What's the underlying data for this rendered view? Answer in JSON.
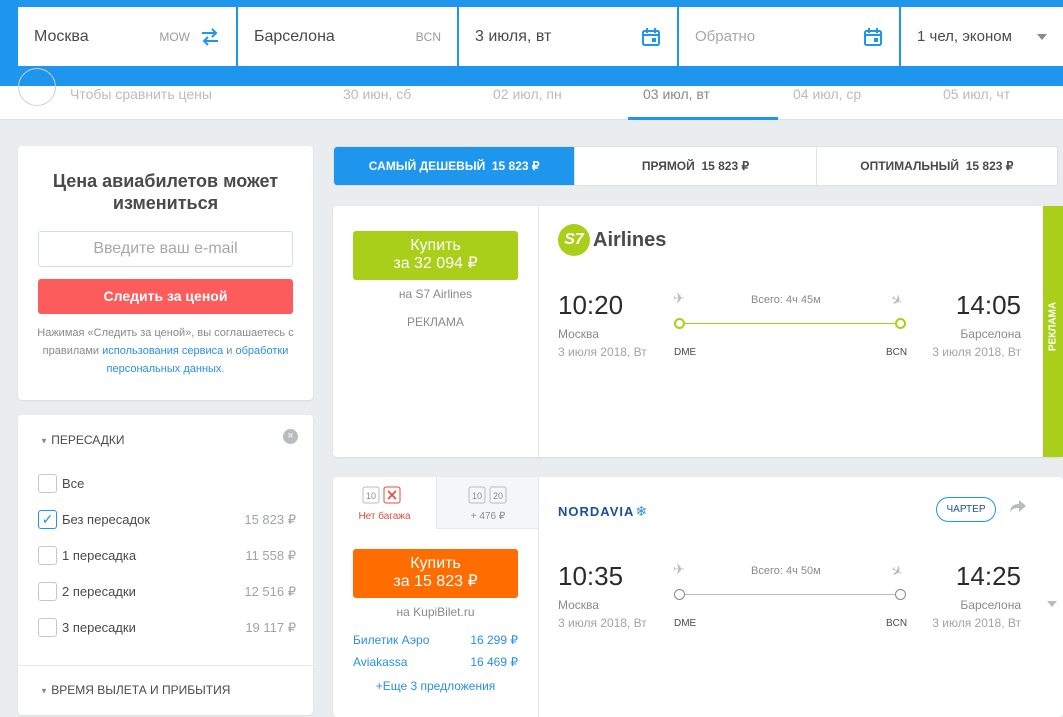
{
  "search": {
    "from_city": "Москва",
    "from_code": "MOW",
    "to_city": "Барселона",
    "to_code": "BCN",
    "depart_date": "3 июля, вт",
    "return_placeholder": "Обратно",
    "passengers": "1 чел, эконом"
  },
  "datebar": {
    "compare_text": "Чтобы сравнить цены",
    "dates": [
      "30 июн, сб",
      "02 июл, пн",
      "03 июл, вт",
      "04 июл, ср",
      "05 июл, чт"
    ]
  },
  "price_alert": {
    "title": "Цена авиабилетов может измениться",
    "email_placeholder": "Введите ваш e-mail",
    "button": "Следить за ценой",
    "agree_text_1": "Нажимая «Следить за ценой», вы соглашаетесь с правилами",
    "agree_link_1": "использования сервиса",
    "agree_and": "и",
    "agree_link_2": "обработки персональных данных",
    "agree_end": "."
  },
  "filters": {
    "stops_title": "ПЕРЕСАДКИ",
    "options": [
      {
        "label": "Все",
        "price": "",
        "checked": false
      },
      {
        "label": "Без пересадок",
        "price": "15 823 ₽",
        "checked": true
      },
      {
        "label": "1 пересадка",
        "price": "11 558 ₽",
        "checked": false
      },
      {
        "label": "2 пересадки",
        "price": "12 516 ₽",
        "checked": false
      },
      {
        "label": "3 пересадки",
        "price": "19 117 ₽",
        "checked": false
      }
    ],
    "times_title": "ВРЕМЯ ВЫЛЕТА И ПРИБЫТИЯ"
  },
  "sort_tabs": [
    {
      "label": "САМЫЙ ДЕШЕВЫЙ",
      "price": "15 823 ₽"
    },
    {
      "label": "ПРЯМОЙ",
      "price": "15 823 ₽"
    },
    {
      "label": "ОПТИМАЛЬНЫЙ",
      "price": "15 823 ₽"
    }
  ],
  "ticket1": {
    "buy_label": "Купить",
    "buy_price": "за 32 094 ₽",
    "seller": "на S7 Airlines",
    "ad_label": "РЕКЛАМА",
    "airline_logo_text": "S7",
    "airline_name": "Airlines",
    "dep_time": "10:20",
    "dep_city": "Москва",
    "dep_date": "3 июля 2018, Вт",
    "dep_iata": "DME",
    "arr_time": "14:05",
    "arr_city": "Барселона",
    "arr_date": "3 июля 2018, Вт",
    "arr_iata": "BCN",
    "duration": "Всего: 4ч 45м",
    "side_label": "РЕКЛАМА"
  },
  "ticket2": {
    "bag_option_1": "Нет багажа",
    "bag_option_2": "+ 476 ₽",
    "bag_weight_a": "10",
    "bag_weight_b": "20",
    "buy_label": "Купить",
    "buy_price": "за 15 823 ₽",
    "seller": "на KupiBilet.ru",
    "offers": [
      {
        "name": "Билетик Аэро",
        "price": "16 299 ₽"
      },
      {
        "name": "Aviakassa",
        "price": "16 469 ₽"
      }
    ],
    "more_offers": "+Еще 3 предложения",
    "airline_name": "NORDAVIA",
    "charter_badge": "ЧАРТЕР",
    "dep_time": "10:35",
    "dep_city": "Москва",
    "dep_date": "3 июля 2018, Вт",
    "dep_iata": "DME",
    "arr_time": "14:25",
    "arr_city": "Барселона",
    "arr_date": "3 июля 2018, Вт",
    "arr_iata": "BCN",
    "duration": "Всего: 4ч 50м"
  },
  "colors": {
    "accent": "#1e96ee",
    "buy_green": "#a9cf1b",
    "buy_orange": "#ff6d00",
    "alert_red": "#fd5c5c"
  }
}
